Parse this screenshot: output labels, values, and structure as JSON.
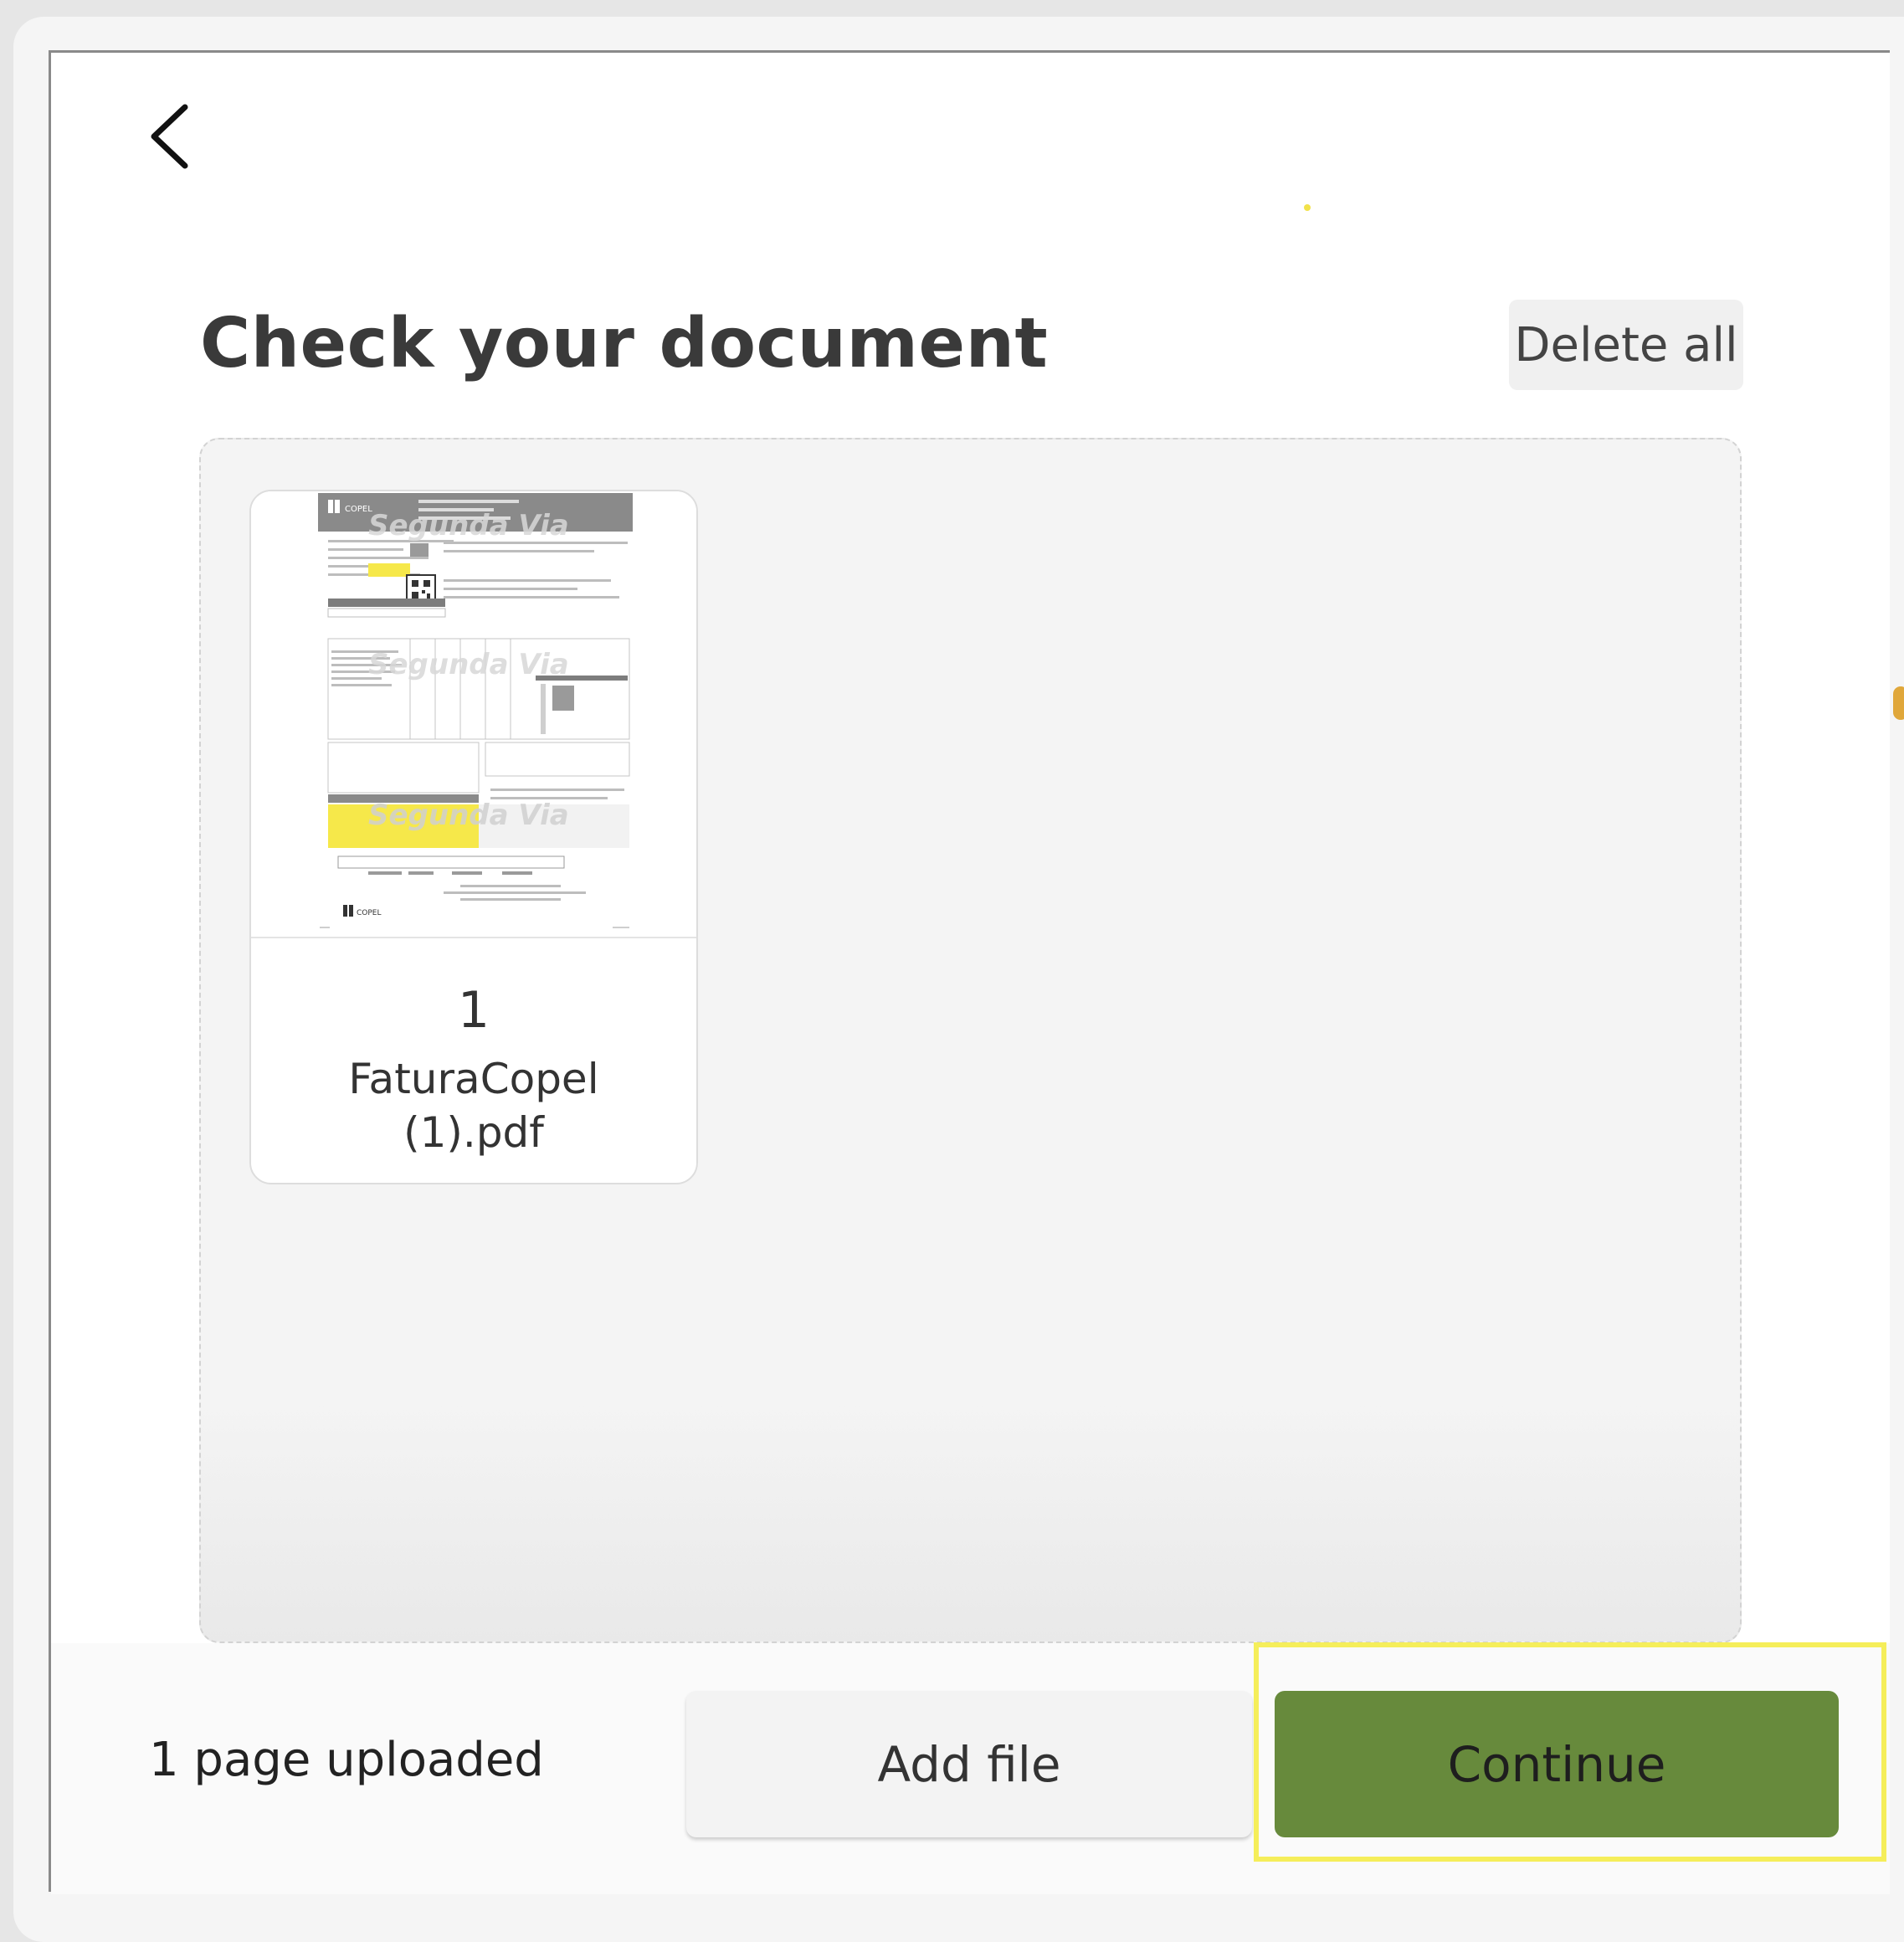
{
  "header": {
    "back_icon": "chevron-left-icon",
    "title": "Check your document",
    "delete_all_label": "Delete all"
  },
  "documents": [
    {
      "page_number": "1",
      "file_name": "FaturaCopel (1).pdf",
      "thumbnail": {
        "brand": "COPEL",
        "watermark": "Segunda Via"
      }
    }
  ],
  "footer": {
    "status": "1 page uploaded",
    "add_file_label": "Add file",
    "continue_label": "Continue"
  },
  "colors": {
    "primary_button": "#678a3c",
    "highlight": "#f5ee5a",
    "invoice_accent": "#f6e84a"
  }
}
